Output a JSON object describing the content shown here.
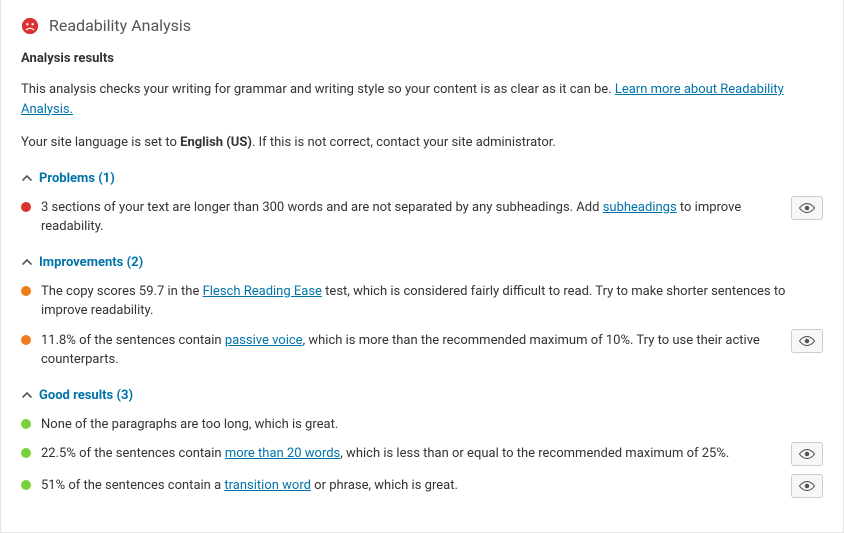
{
  "header": {
    "title": "Readability Analysis",
    "face_icon": "sad-face-icon",
    "face_color": "#dc3232"
  },
  "results_heading": "Analysis results",
  "intro": {
    "text_before_link": "This analysis checks your writing for grammar and writing style so your content is as clear as it can be. ",
    "link_text": "Learn more about Readability Analysis.",
    "text_after_link": ""
  },
  "language_line": {
    "before": "Your site language is set to ",
    "lang": "English (US)",
    "after": ". If this is not correct, contact your site administrator."
  },
  "sections": {
    "problems": {
      "label": "Problems (1)",
      "items": [
        {
          "bullet": "red",
          "before": "3 sections of your text are longer than 300 words and are not separated by any subheadings. Add ",
          "link": "subheadings",
          "after": " to improve readability.",
          "has_eye": true
        }
      ]
    },
    "improvements": {
      "label": "Improvements (2)",
      "items": [
        {
          "bullet": "orange",
          "before": "The copy scores 59.7 in the ",
          "link": "Flesch Reading Ease",
          "after": " test, which is considered fairly difficult to read. Try to make shorter sentences to improve readability.",
          "has_eye": false
        },
        {
          "bullet": "orange",
          "before": "11.8% of the sentences contain ",
          "link": "passive voice",
          "after": ", which is more than the recommended maximum of 10%. Try to use their active counterparts.",
          "has_eye": true
        }
      ]
    },
    "good": {
      "label": "Good results (3)",
      "items": [
        {
          "bullet": "green",
          "before": "None of the paragraphs are too long, which is great.",
          "link": "",
          "after": "",
          "has_eye": false
        },
        {
          "bullet": "green",
          "before": "22.5% of the sentences contain ",
          "link": "more than 20 words",
          "after": ", which is less than or equal to the recommended maximum of 25%.",
          "has_eye": true
        },
        {
          "bullet": "green",
          "before": "51% of the sentences contain a ",
          "link": "transition word",
          "after": " or phrase, which is great.",
          "has_eye": true
        }
      ]
    }
  }
}
